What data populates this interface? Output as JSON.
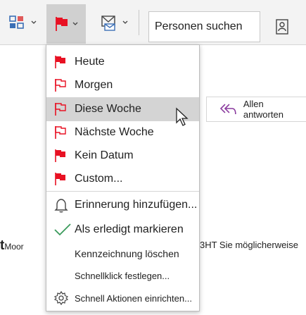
{
  "toolbar": {
    "people_search_label": "Personen suchen",
    "icons": [
      "categorize-icon",
      "flag-icon",
      "mail-rules-icon",
      "address-book-icon"
    ],
    "flag_color": "#e81123"
  },
  "flag_menu": {
    "items": [
      {
        "label": "Heute"
      },
      {
        "label": "Morgen"
      },
      {
        "label": "Diese Woche"
      },
      {
        "label": "Nächste Woche"
      },
      {
        "label": "Kein Datum"
      },
      {
        "label": "Custom..."
      },
      {
        "label": "Erinnerung hinzufügen..."
      },
      {
        "label": "Als erledigt markieren"
      },
      {
        "label": "Kennzeichnung löschen"
      },
      {
        "label": "Schnellklick festlegen..."
      },
      {
        "label": "Schnell Aktionen einrichten..."
      }
    ],
    "highlighted_item": "Diese Woche"
  },
  "reading_pane": {
    "reply_all_label": "Allen antworten",
    "snippet_left_big": "t",
    "snippet_left": "Moor",
    "snippet_right": "3HT Sie möglicherweise"
  }
}
